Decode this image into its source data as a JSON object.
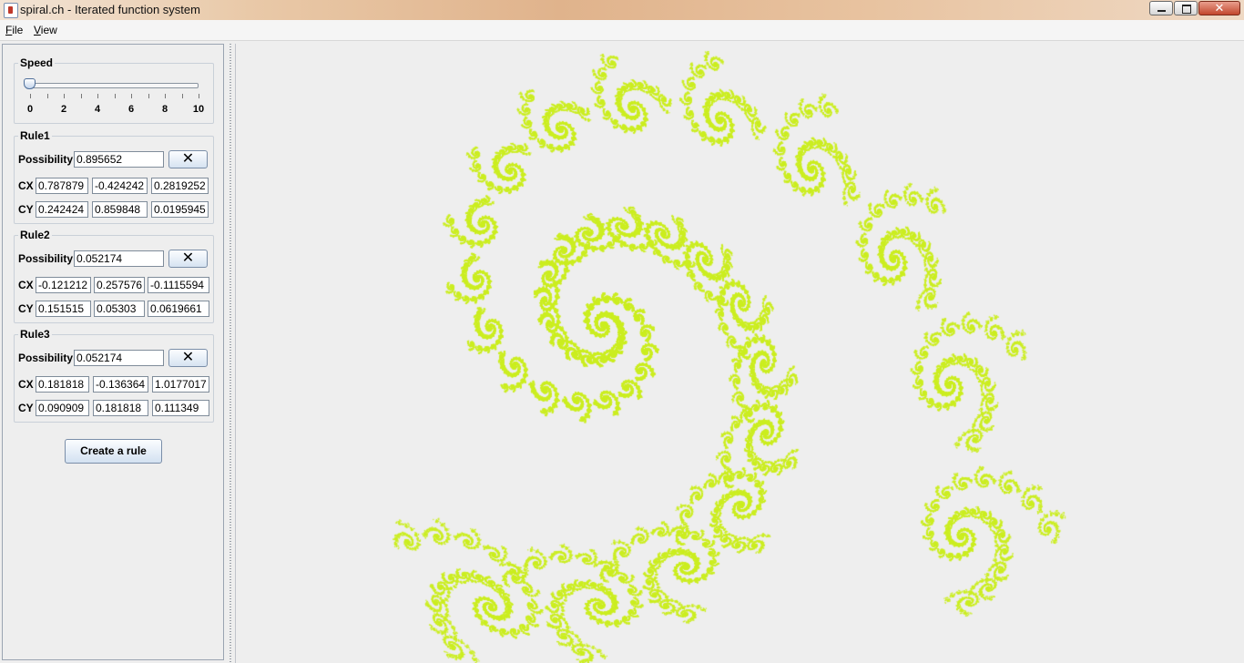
{
  "window": {
    "title": "spiral.ch - Iterated function system",
    "close_glyph": "✕"
  },
  "menu": [
    {
      "mnemonic": "F",
      "rest": "ile"
    },
    {
      "mnemonic": "V",
      "rest": "iew"
    }
  ],
  "speed": {
    "title": "Speed",
    "min": 0,
    "max": 10,
    "value": 0,
    "tick_labels": [
      "0",
      "2",
      "4",
      "6",
      "8",
      "10"
    ]
  },
  "rules": [
    {
      "title": "Rule1",
      "possibility_label": "Possibility",
      "possibility": "0.895652",
      "delete_glyph": "✕",
      "cx_label": "CX",
      "cx": [
        "0.787879",
        "-0.424242",
        "0.2819252"
      ],
      "cy_label": "CY",
      "cy": [
        "0.242424",
        "0.859848",
        "0.0195945"
      ]
    },
    {
      "title": "Rule2",
      "possibility_label": "Possibility",
      "possibility": "0.052174",
      "delete_glyph": "✕",
      "cx_label": "CX",
      "cx": [
        "-0.121212",
        "0.257576",
        "-0.1115594"
      ],
      "cy_label": "CY",
      "cy": [
        "0.151515",
        "0.05303",
        "0.0619661"
      ]
    },
    {
      "title": "Rule3",
      "possibility_label": "Possibility",
      "possibility": "0.052174",
      "delete_glyph": "✕",
      "cx_label": "CX",
      "cx": [
        "0.181818",
        "-0.136364",
        "1.0177017"
      ],
      "cy_label": "CY",
      "cy": [
        "0.090909",
        "0.181818",
        "0.111349"
      ]
    }
  ],
  "create_rule_label": "Create a rule",
  "colors": {
    "fractal": "#ccee22",
    "background": "#eeeeee"
  }
}
